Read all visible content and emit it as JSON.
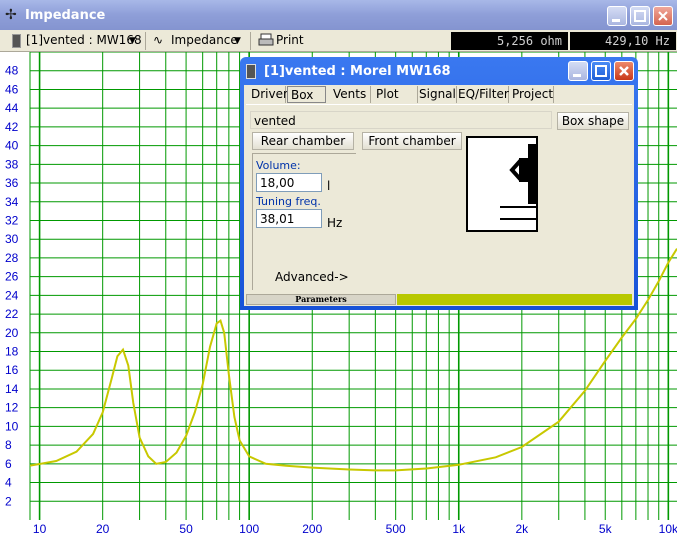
{
  "window": {
    "title": "Impedance",
    "app_icon": "crosshair-icon"
  },
  "toolbar": {
    "driver_select": "[1]vented : MW168",
    "view_select": "Impedance",
    "print_label": "Print",
    "readout_impedance": "5,256 ohm",
    "readout_frequency": "429,10 Hz"
  },
  "chart": {
    "y_ticks": [
      "2",
      "4",
      "6",
      "8",
      "10",
      "12",
      "14",
      "16",
      "18",
      "20",
      "22",
      "24",
      "26",
      "28",
      "30",
      "32",
      "34",
      "36",
      "38",
      "40",
      "42",
      "44",
      "46",
      "48"
    ],
    "x_ticks": [
      "10",
      "20",
      "50",
      "100",
      "200",
      "500",
      "1k",
      "2k",
      "5k",
      "10k"
    ]
  },
  "dialog": {
    "title": "[1]vented : Morel MW168",
    "tabs": [
      "Driver",
      "Box",
      "Vents",
      "Plot",
      "Signal",
      "EQ/Filter",
      "Project"
    ],
    "selected_tab": "Box",
    "box_name": "vented",
    "box_shape_button": "Box shape",
    "rear_chamber_button": "Rear chamber",
    "front_chamber_button": "Front chamber",
    "volume_label": "Volume:",
    "volume_value": "18,00",
    "volume_unit": "l",
    "tuning_label": "Tuning freq.",
    "tuning_value": "38,01",
    "tuning_unit": "Hz",
    "advanced_link": "Advanced->",
    "status_label": "Parameters"
  },
  "chart_data": {
    "type": "line",
    "xscale": "log",
    "xlim": [
      9,
      11000
    ],
    "ylim": [
      0,
      50
    ],
    "grid": true,
    "colors": {
      "curve": "#c8c800",
      "grid": "#009900",
      "ticks": "#0000cc"
    },
    "x": [
      9,
      12,
      15,
      18,
      20,
      22,
      23.5,
      25,
      26.5,
      28,
      30,
      33,
      36,
      40,
      45,
      50,
      55,
      60,
      65,
      70,
      73,
      76,
      80,
      85,
      90,
      100,
      120,
      150,
      200,
      300,
      400,
      500,
      700,
      1000,
      1500,
      2000,
      3000,
      4000,
      5000,
      6000,
      7000,
      8000,
      9000,
      10000,
      11000
    ],
    "y": [
      5.8,
      6.3,
      7.3,
      9.2,
      11.5,
      15.0,
      17.5,
      18.2,
      16.5,
      12.5,
      8.8,
      6.8,
      6.0,
      6.2,
      7.2,
      9.0,
      11.5,
      14.5,
      18.5,
      21.0,
      21.3,
      20.0,
      15.5,
      11.0,
      8.5,
      6.8,
      6.0,
      5.8,
      5.6,
      5.4,
      5.3,
      5.3,
      5.5,
      5.9,
      6.7,
      7.8,
      10.5,
      13.8,
      17.0,
      19.5,
      21.5,
      23.5,
      25.5,
      27.5,
      29.0
    ]
  }
}
